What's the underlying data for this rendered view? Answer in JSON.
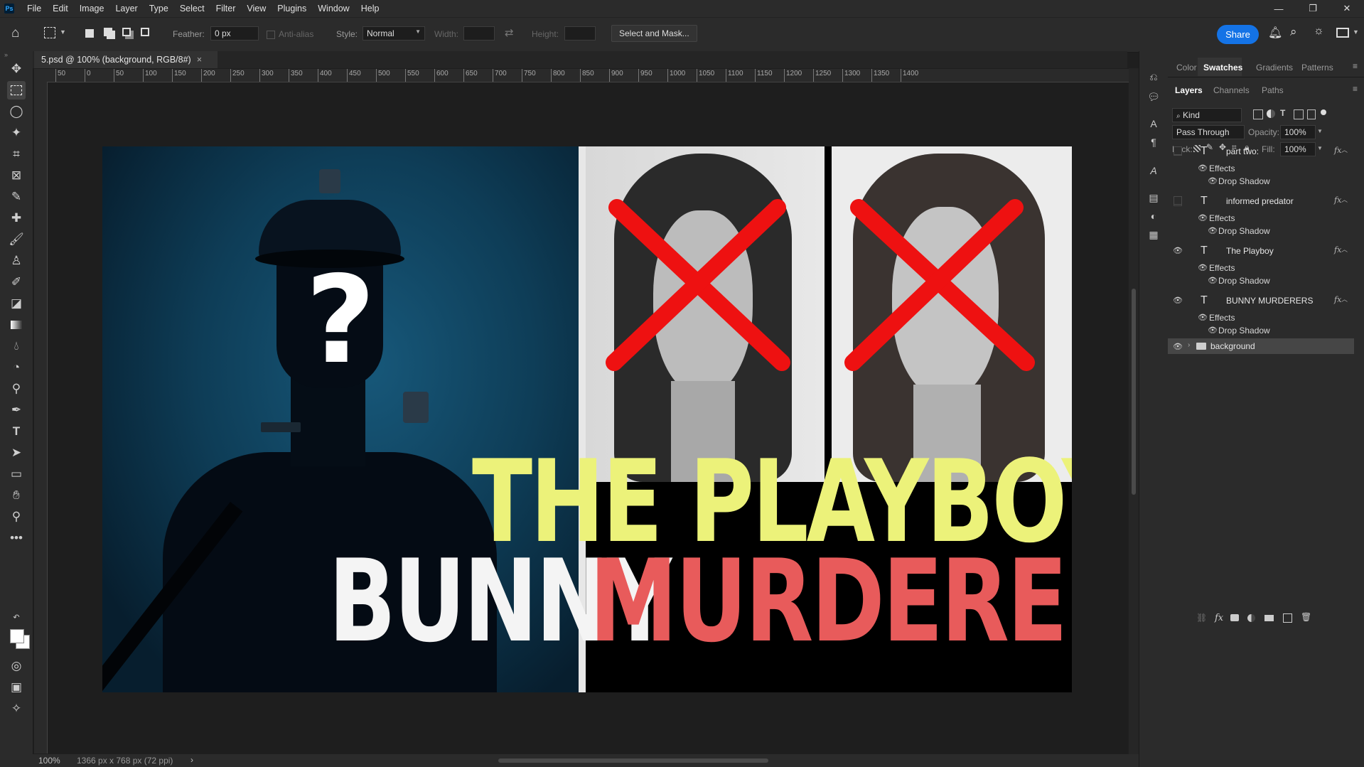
{
  "app": {
    "logo": "Ps"
  },
  "menu": [
    "File",
    "Edit",
    "Image",
    "Layer",
    "Type",
    "Select",
    "Filter",
    "View",
    "Plugins",
    "Window",
    "Help"
  ],
  "window_controls": {
    "minimize": "—",
    "restore": "❐",
    "close": "✕"
  },
  "options": {
    "feather_label": "Feather:",
    "feather_value": "0 px",
    "antialias_label": "Anti-alias",
    "style_label": "Style:",
    "style_value": "Normal",
    "width_label": "Width:",
    "height_label": "Height:",
    "select_mask": "Select and Mask...",
    "share": "Share"
  },
  "document": {
    "tab_title": "5.psd @ 100% (background, RGB/8#)",
    "tab_close": "×"
  },
  "ruler_labels": [
    "50",
    "0",
    "50",
    "100",
    "150",
    "200",
    "250",
    "300",
    "350",
    "400",
    "450",
    "500",
    "550",
    "600",
    "650",
    "700",
    "750",
    "800",
    "850",
    "900",
    "950",
    "1000",
    "1050",
    "1100",
    "1150",
    "1200",
    "1250",
    "1300",
    "1350",
    "1400"
  ],
  "status": {
    "zoom": "100%",
    "size": "1366 px x 768 px (72 ppi)",
    "arrow": "›"
  },
  "artwork": {
    "question": "?",
    "title_line1": "THE PLAYBOY",
    "title_line2a": "BUNNY",
    "title_line2b": "MURDERERS",
    "colors": {
      "yellow": "#ecf27a",
      "white": "#ffffff",
      "red": "#e85b5b",
      "cross": "#ee1111"
    }
  },
  "panels": {
    "top_tabs": [
      "Color",
      "Swatches",
      "Gradients",
      "Patterns"
    ],
    "top_active": "Swatches",
    "layer_tabs": [
      "Layers",
      "Channels",
      "Paths"
    ],
    "layer_active": "Layers",
    "kind": "Kind",
    "blend": "Pass Through",
    "opacity_label": "Opacity:",
    "opacity": "100%",
    "lock_label": "Lock:",
    "fill_label": "Fill:",
    "fill": "100%"
  },
  "layers": [
    {
      "name": "part two:",
      "visible": false,
      "effects": "Effects",
      "effect": "Drop Shadow"
    },
    {
      "name": "informed predator",
      "visible": false,
      "effects": "Effects",
      "effect": "Drop Shadow"
    },
    {
      "name": "The Playboy",
      "visible": true,
      "effects": "Effects",
      "effect": "Drop Shadow"
    },
    {
      "name": "BUNNY MURDERERS",
      "visible": true,
      "effects": "Effects",
      "effect": "Drop Shadow"
    },
    {
      "name": "background",
      "visible": true
    }
  ]
}
